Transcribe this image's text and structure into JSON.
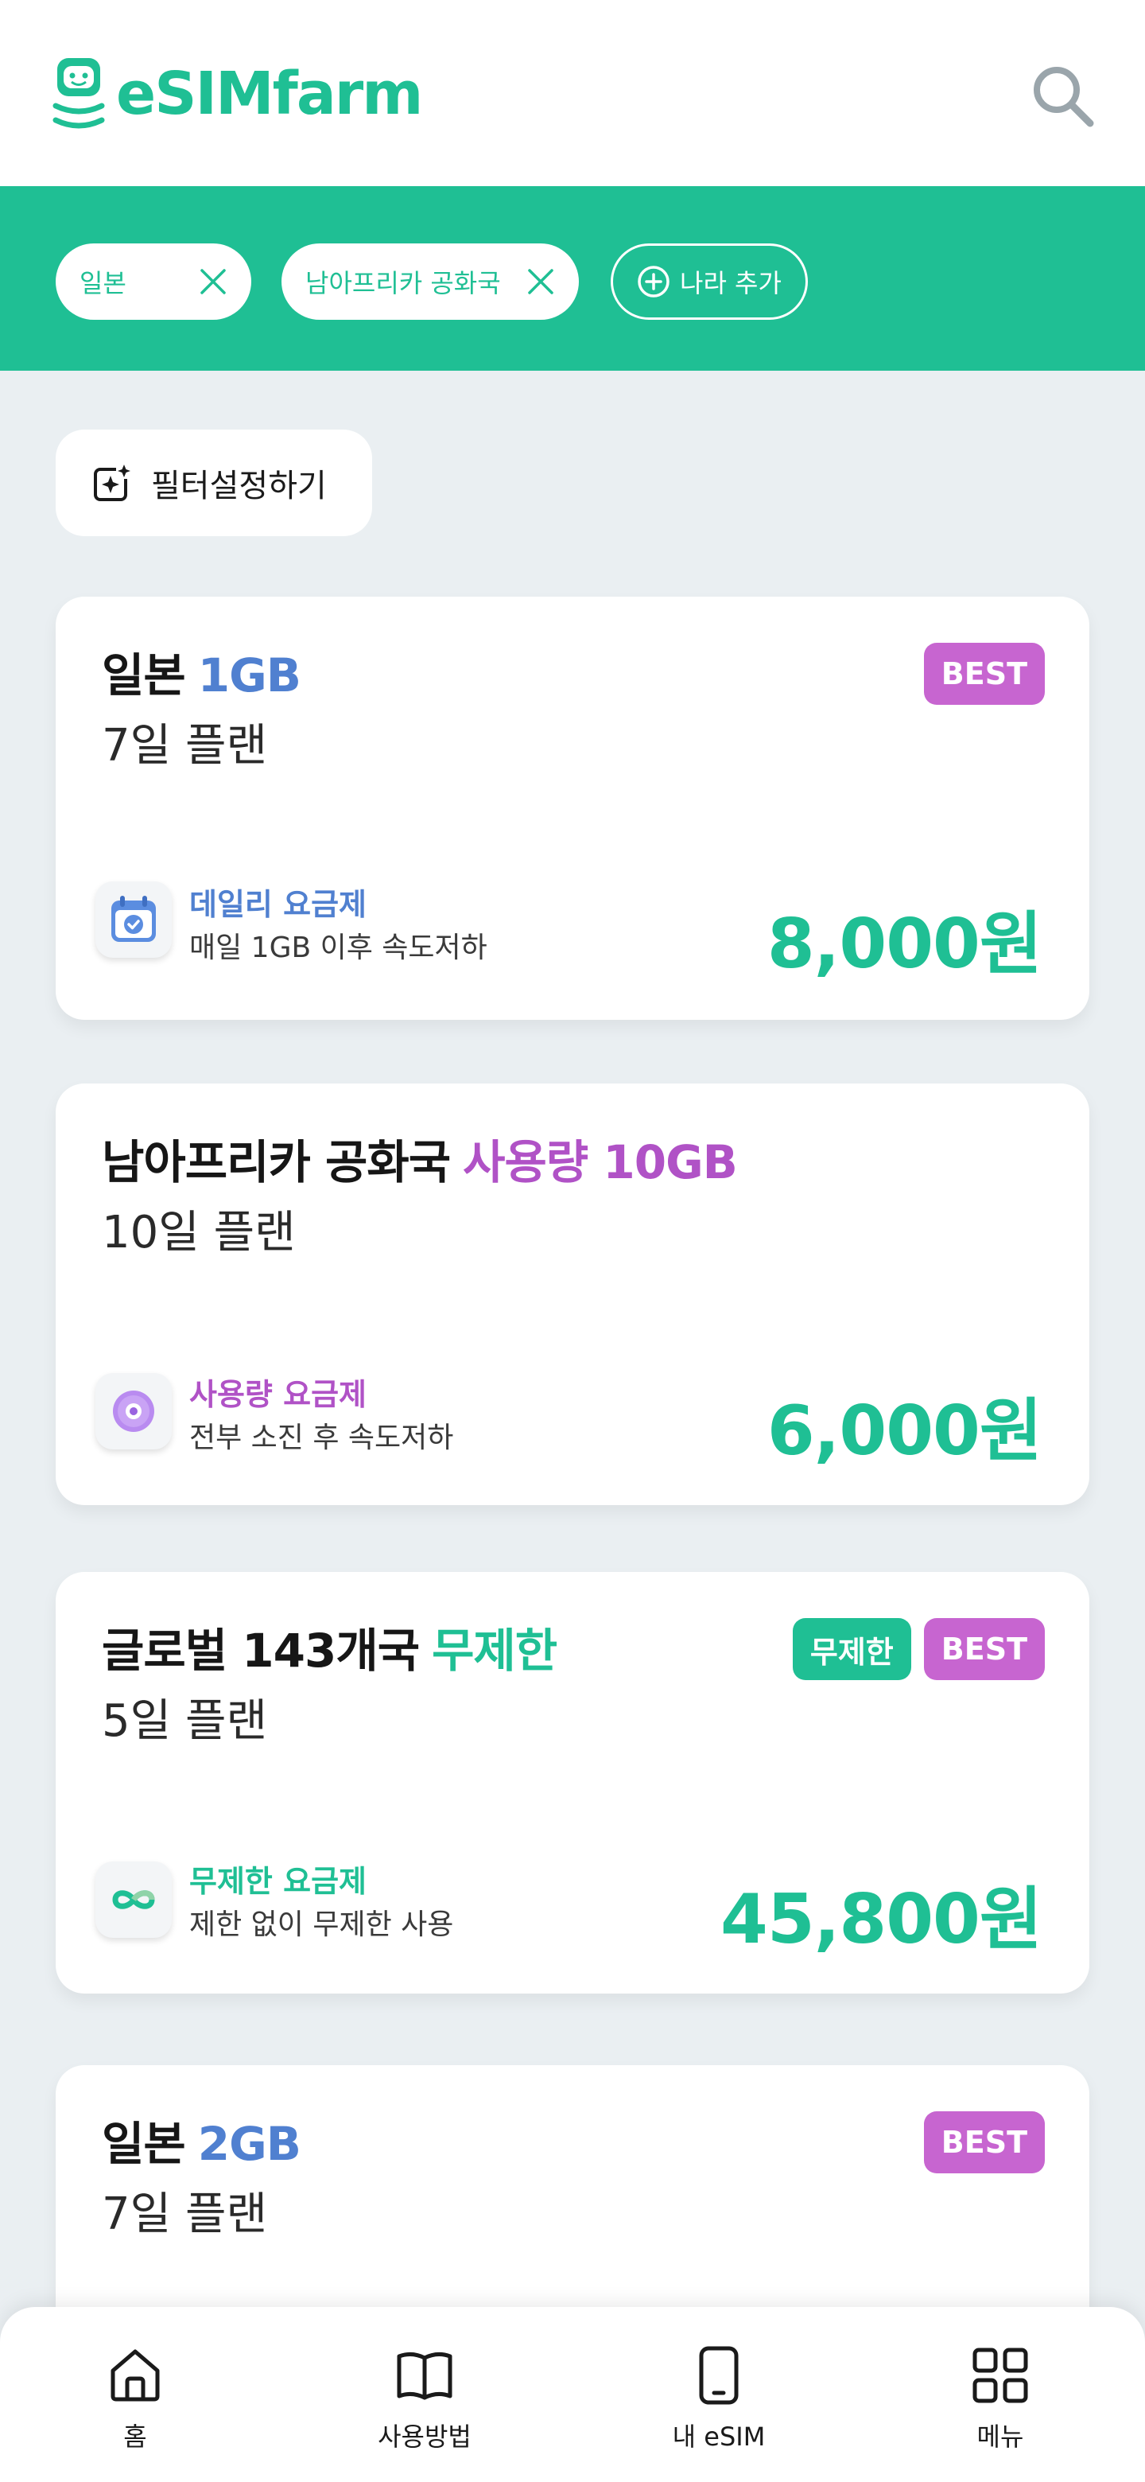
{
  "header": {
    "logo_text": "eSIMfarm",
    "search_icon": "search-icon"
  },
  "countries": [
    {
      "label": "일본"
    },
    {
      "label": "남아프리카 공화국"
    }
  ],
  "add_country_label": "나라 추가",
  "filter": {
    "label": "필터설정하기"
  },
  "plans": [
    {
      "country": "일본",
      "data": "1GB",
      "duration": "7일 플랜",
      "badges": [
        "BEST"
      ],
      "plan_type": "데일리 요금제",
      "description": "매일 1GB 이후 속도저하",
      "price": "8,000원",
      "icon": "calendar-icon"
    },
    {
      "country": "남아프리카 공화국",
      "data": "사용량 10GB",
      "duration": "10일 플랜",
      "badges": [],
      "plan_type": "사용량 요금제",
      "description": "전부 소진 후 속도저하",
      "price": "6,000원",
      "icon": "data-donut-icon"
    },
    {
      "country": "글로벌 143개국",
      "data": "무제한",
      "duration": "5일 플랜",
      "badges": [
        "무제한",
        "BEST"
      ],
      "plan_type": "무제한 요금제",
      "description": "제한 없이 무제한 사용",
      "price": "45,800원",
      "icon": "infinity-icon"
    },
    {
      "country": "일본",
      "data": "2GB",
      "duration": "7일 플랜",
      "badges": [
        "BEST"
      ]
    }
  ],
  "nav": [
    {
      "label": "홈",
      "icon": "home-icon"
    },
    {
      "label": "사용방법",
      "icon": "book-icon"
    },
    {
      "label": "내 eSIM",
      "icon": "phone-icon"
    },
    {
      "label": "메뉴",
      "icon": "grid-menu-icon"
    }
  ],
  "colors": {
    "brand_green": "#1fbf94",
    "best_purple": "#c765d0",
    "data_blue": "#5080d0",
    "usage_purple": "#b052c6"
  }
}
